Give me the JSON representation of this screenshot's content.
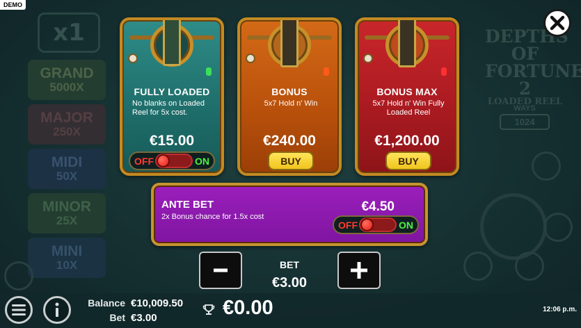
{
  "demo_badge": "DEMO",
  "background": {
    "multiplier": "x1",
    "jackpots": [
      {
        "name": "GRAND",
        "value": "5000X"
      },
      {
        "name": "MAJOR",
        "value": "250X"
      },
      {
        "name": "MIDI",
        "value": "50X"
      },
      {
        "name": "MINOR",
        "value": "25X"
      },
      {
        "name": "MINI",
        "value": "10X"
      }
    ],
    "logo_lines": [
      "DEPTHS OF",
      "FORTUNE 2",
      "LOADED REEL"
    ],
    "ways_label": "WAYS",
    "ways_value": "1024"
  },
  "buy_cards": [
    {
      "title": "FULLY LOADED",
      "description": "No blanks on Loaded Reel for 5x cost.",
      "price": "€15.00",
      "control": "toggle"
    },
    {
      "title": "BONUS",
      "description": "5x7 Hold n' Win",
      "price": "€240.00",
      "button_label": "BUY"
    },
    {
      "title": "BONUS MAX",
      "description": "5x7 Hold n' Win Fully Loaded Reel",
      "price": "€1,200.00",
      "button_label": "BUY"
    }
  ],
  "toggle": {
    "off_label": "OFF",
    "on_label": "ON",
    "state": "off"
  },
  "ante_bet": {
    "title": "ANTE BET",
    "description": "2x Bonus chance for 1.5x cost",
    "price": "€4.50"
  },
  "bet": {
    "label": "BET",
    "amount": "€3.00"
  },
  "footer": {
    "balance_label": "Balance",
    "balance_value": "€10,009.50",
    "bet_label": "Bet",
    "bet_value": "€3.00",
    "win_value": "€0.00",
    "clock": "12:06 p.m."
  },
  "colors": {
    "fully_loaded": "#1e6d6a",
    "bonus": "#b8500b",
    "bonus_max": "#a81a20",
    "ante_bet": "#8a18ab",
    "buy_button": "#f0c51e",
    "frame_gold": "#c38a22"
  },
  "icons": {
    "close": "close-icon",
    "menu": "menu-icon",
    "info": "info-icon",
    "minus": "minus-icon",
    "plus": "plus-icon",
    "win": "trophy-icon"
  }
}
